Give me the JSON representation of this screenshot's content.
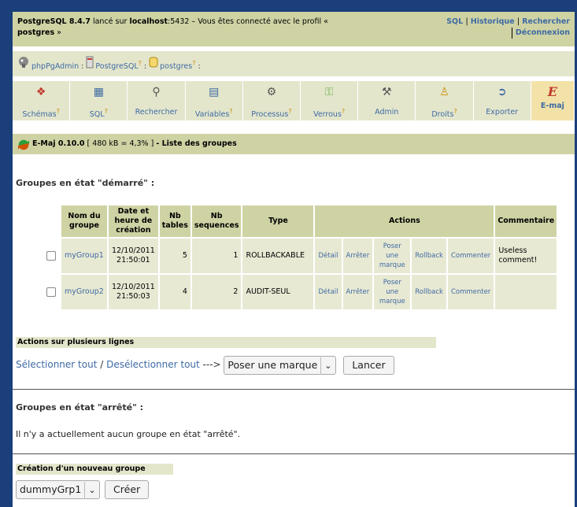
{
  "topbar": {
    "server_name": "PostgreSQL 8.4.7",
    "text_launched": " lancé sur ",
    "host": "localhost",
    "port_text": ":5432 – Vous êtes connecté avec le profil «",
    "profile": "postgres",
    "close_quote": " »",
    "links": {
      "sql": "SQL",
      "history": "Historique",
      "search": "Rechercher",
      "logout": "Déconnexion"
    }
  },
  "breadcrumb": {
    "app": "phpPgAdmin",
    "server": "PostgreSQL",
    "database": "postgres",
    "help": "?",
    "sep": ":"
  },
  "tabs": [
    {
      "label": "Schémas",
      "help": "?",
      "icon": "schemas-icon",
      "glyph": "❖"
    },
    {
      "label": "SQL",
      "help": "?",
      "icon": "sql-icon",
      "glyph": "▦"
    },
    {
      "label": "Rechercher",
      "help": "",
      "icon": "search-icon",
      "glyph": "⚲"
    },
    {
      "label": "Variables",
      "help": "?",
      "icon": "variables-icon",
      "glyph": "▤"
    },
    {
      "label": "Processus",
      "help": "?",
      "icon": "processes-icon",
      "glyph": "⚙"
    },
    {
      "label": "Verrous",
      "help": "?",
      "icon": "locks-icon",
      "glyph": "⚿"
    },
    {
      "label": "Admin",
      "help": "",
      "icon": "admin-icon",
      "glyph": "⚒"
    },
    {
      "label": "Droits",
      "help": "?",
      "icon": "privileges-icon",
      "glyph": "♙"
    },
    {
      "label": "Exporter",
      "help": "",
      "icon": "export-icon",
      "glyph": "➲"
    },
    {
      "label": "E-maj",
      "help": "",
      "icon": "emaj-icon",
      "glyph": "E"
    }
  ],
  "emaj": {
    "title": "E-Maj 0.10.0",
    "size": " [ 480 kB = 4,3% ] ",
    "subtitle": " - Liste des groupes"
  },
  "started": {
    "title": "Groupes en état \"démarré\" :",
    "headers": {
      "name": "Nom du groupe",
      "date": "Date et heure de création",
      "nb_tables": "Nb tables",
      "nb_sequences": "Nb sequences",
      "type": "Type",
      "actions": "Actions",
      "comment": "Commentaire"
    },
    "rows": [
      {
        "name": "myGroup1",
        "date": "12/10/2011",
        "time": "21:50:01",
        "tables": "5",
        "sequences": "1",
        "type": "ROLLBACKABLE",
        "a_detail": "Détail",
        "a_stop": "Arrêter",
        "a_mark": "Poser une marque",
        "a_rollback": "Rollback",
        "a_comment": "Commenter",
        "comment": "Useless comment!"
      },
      {
        "name": "myGroup2",
        "date": "12/10/2011",
        "time": "21:50:03",
        "tables": "4",
        "sequences": "2",
        "type": "AUDIT-SEUL",
        "a_detail": "Détail",
        "a_stop": "Arrêter",
        "a_mark": "Poser une marque",
        "a_rollback": "Rollback",
        "a_comment": "Commenter",
        "comment": ""
      }
    ]
  },
  "multi": {
    "title": "Actions sur plusieurs lignes",
    "select_all": "Sélectionner tout",
    "slash": " / ",
    "deselect_all": "Desélectionner tout",
    "arrow": " ---> ",
    "action_selected": "Poser une marque",
    "submit": "Lancer"
  },
  "stopped": {
    "title": "Groupes en état \"arrêté\" :",
    "empty": "Il n'y a actuellement aucun groupe en état \"arrêté\"."
  },
  "create": {
    "title": "Création d'un nouveau groupe",
    "selected_group": "dummyGrp1",
    "submit": "Créer"
  }
}
